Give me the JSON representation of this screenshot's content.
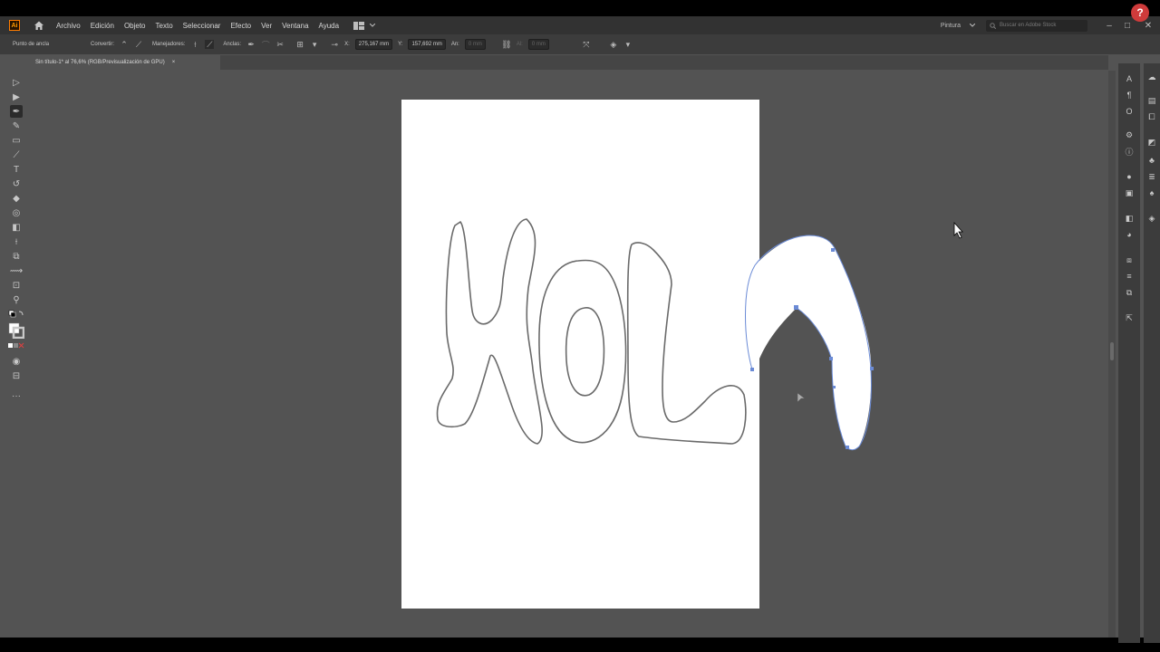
{
  "app": {
    "logo_text": "Ai",
    "menu": [
      "Archivo",
      "Edición",
      "Objeto",
      "Texto",
      "Seleccionar",
      "Efecto",
      "Ver",
      "Ventana",
      "Ayuda"
    ],
    "workspace": "Pintura",
    "stock_search_placeholder": "Buscar en Adobe Stock",
    "help_label": "?"
  },
  "control_bar": {
    "anchor_label": "Punto de ancla",
    "convert_label": "Convertir:",
    "handles_label": "Manejadores:",
    "anchors_label": "Anclas:",
    "x_label": "X:",
    "x_value": "275,167 mm",
    "y_label": "Y:",
    "y_value": "157,692 mm",
    "w_label": "An:",
    "w_value": "0 mm",
    "h_label": "Al:",
    "h_value": "0 mm"
  },
  "document": {
    "tab_title": "Sin título-1* al 76,6% (RGB/Previsualización de GPU)",
    "close_label": "×"
  },
  "icons": {
    "home": "home-icon",
    "tools": [
      "selection-tool-icon",
      "direct-selection-icon",
      "pen-tool-icon",
      "curvature-tool-icon",
      "rectangle-tool-icon",
      "paintbrush-icon",
      "type-tool-icon",
      "rotate-icon",
      "eraser-icon",
      "lasso-icon",
      "gradient-icon",
      "eyedropper-icon",
      "shape-builder-icon",
      "width-tool-icon",
      "artboard-icon",
      "zoom-icon"
    ]
  },
  "colors": {
    "accent_path": "#6b8bd6",
    "shape_fill": "#ffffff",
    "canvas_bg": "#535353",
    "help_button": "#cf3b3b"
  }
}
